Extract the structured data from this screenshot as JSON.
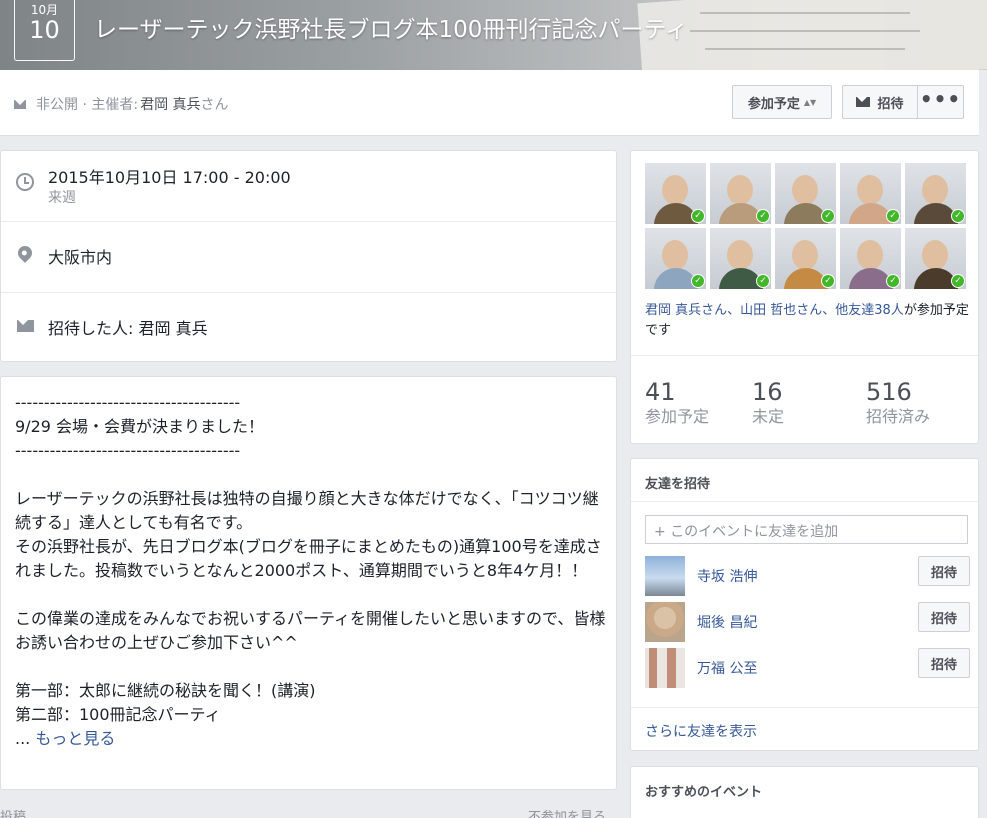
{
  "header": {
    "date_month": "10月",
    "date_day": "10",
    "title": "レーザーテック浜野社長ブログ本100冊刊行記念パーティ"
  },
  "actionbar": {
    "privacy": "非公開 · 主催者:",
    "host_name": "君岡 真兵",
    "host_suffix": "さん",
    "going_label": "参加予定",
    "invite_label": "招待",
    "more_label": "•••"
  },
  "details": {
    "datetime": "2015年10月10日 17:00 - 20:00",
    "relative": "来週",
    "location": "大阪市内",
    "invited_by": "招待した人: 君岡 真兵"
  },
  "description": {
    "body": "---------------------------------------\n9/29 会場・会費が決まりました！\n---------------------------------------\n\nレーザーテックの浜野社長は独特の自撮り顔と大きな体だけでなく、「コツコツ継続する」達人としても有名です。\nその浜野社長が、先日ブログ本(ブログを冊子にまとめたもの)通算100号を達成されました。投稿数でいうとなんと2000ポスト、通算期間でいうと8年4ケ月！！\n\nこの偉業の達成をみんなでお祝いするパーティを開催したいと思いますので、皆様お誘い合わせの上ぜひご参加下さい^^\n\n第一部：太郎に継続の秘訣を聞く！(講演)\n第二部：100冊記念パーティ\n",
    "more_prefix": "... ",
    "more_link": "もっと見る"
  },
  "below": {
    "posts_label": "投稿",
    "decline_label": "不参加を見る"
  },
  "guests": {
    "text_names": "君岡 真兵さん、山田 哲也さん、他友達38人",
    "text_suffix": "が参加予定です",
    "avatar_colors": [
      "#6d5a3f",
      "#b99c7c",
      "#8c7b5c",
      "#d2a689",
      "#5a4a3a",
      "#8ea5bf",
      "#3f5b46",
      "#c58b45",
      "#8a6d8a",
      "#4a3b2a"
    ],
    "stats": [
      {
        "num": "41",
        "label": "参加予定"
      },
      {
        "num": "16",
        "label": "未定"
      },
      {
        "num": "516",
        "label": "招待済み"
      }
    ]
  },
  "invite": {
    "title": "友達を招待",
    "placeholder": "+ このイベントに友達を追加",
    "friends": [
      {
        "name": "寺坂 浩伸",
        "button": "招待"
      },
      {
        "name": "堀後 昌紀",
        "button": "招待"
      },
      {
        "name": "万福 公至",
        "button": "招待"
      }
    ],
    "see_more": "さらに友達を表示"
  },
  "recommended": {
    "title": "おすすめのイベント"
  }
}
